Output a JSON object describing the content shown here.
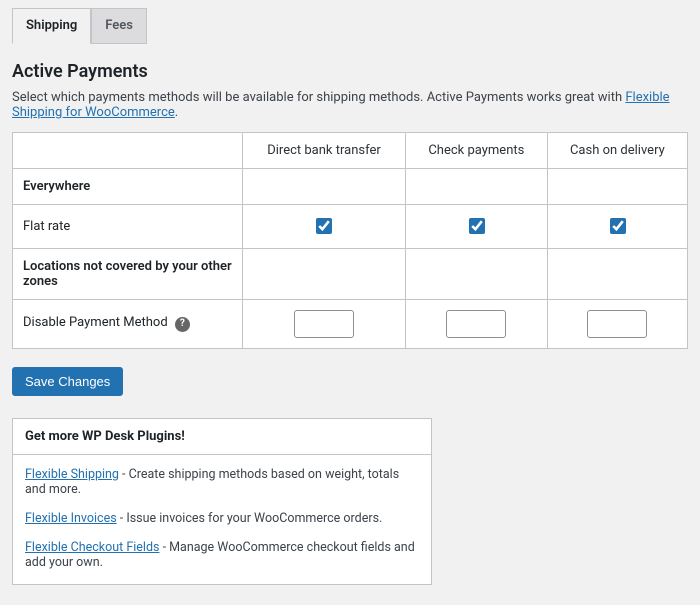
{
  "tabs": {
    "shipping": "Shipping",
    "fees": "Fees"
  },
  "heading": "Active Payments",
  "intro_prefix": "Select which payments methods will be available for shipping methods. Active Payments works great with ",
  "intro_link": "Flexible Shipping for WooCommerce",
  "intro_suffix": ".",
  "columns": {
    "direct_bank": "Direct bank transfer",
    "check": "Check payments",
    "cod": "Cash on delivery"
  },
  "rows": {
    "everywhere": "Everywhere",
    "flat_rate": "Flat rate",
    "not_covered": "Locations not covered by your other zones",
    "disable": "Disable Payment Method"
  },
  "matrix": {
    "flat_rate": {
      "direct_bank": true,
      "check": true,
      "cod": true
    }
  },
  "save_button": "Save Changes",
  "promo": {
    "title": "Get more WP Desk Plugins!",
    "items": {
      "shipping_name": "Flexible Shipping",
      "shipping_desc": " - Create shipping methods based on weight, totals and more.",
      "invoices_name": "Flexible Invoices",
      "invoices_desc": " - Issue invoices for your WooCommerce orders.",
      "checkout_name": "Flexible Checkout Fields",
      "checkout_desc": " - Manage WooCommerce checkout fields and add your own."
    }
  }
}
